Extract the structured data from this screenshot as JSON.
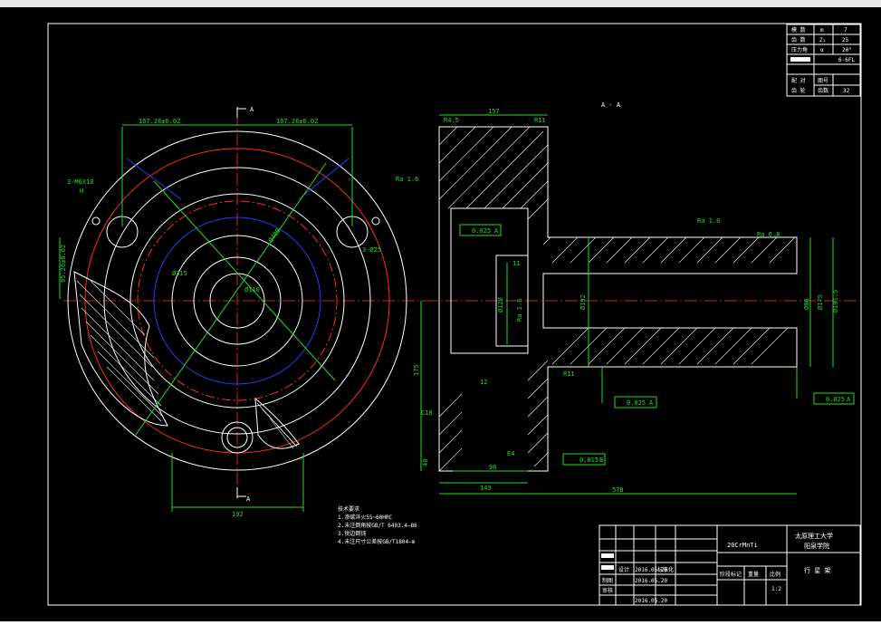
{
  "window": {
    "top_strip": ""
  },
  "drawing": {
    "section_label": "A - A",
    "cut_mark_top": "A",
    "cut_mark_bottom": "A",
    "colors": {
      "background": "#000000",
      "outline": "#ffffff",
      "center_lines": "#ff2a2a",
      "dimensions": "#20e020",
      "hidden": "#2a3cff"
    },
    "front_view_dims": {
      "d_left": "167.26±0.02",
      "d_right": "167.26±0.02",
      "hole_left": "3-M6X18",
      "hole_left_2": "H",
      "hole_right": "3-Ø25",
      "vert_left": "95.26±0.02",
      "ra_top": "Ra 1.6",
      "dia_large": "Ø400",
      "dia_mid": "Ø315",
      "dia_small": "Ø110",
      "bottom_width": "192"
    },
    "section_dims": {
      "r_top_left": "R4.5",
      "top_width": "157",
      "r_top_right": "R11",
      "ra1": "Ra 1.6",
      "ra2": "Ra 6.8",
      "tol1": "0.025",
      "tol1_ref": "A",
      "dim_11": "11",
      "dia_120": "Ø120",
      "ra_small": "Ra 1.6",
      "dia_192": "Ø192",
      "dia_175": "Ø175",
      "dia_86": "Ø86",
      "dia_191": "Ø191.5",
      "r_bottom": "R11",
      "dim_175": "175",
      "dim_12": "12",
      "tol2": "0.025",
      "tol2_ref": "A",
      "tol3": "0.025",
      "tol3_ref": "A",
      "c18": "C18",
      "dim_e4": "E4",
      "tol4": "0.015",
      "tol4_ref": "B",
      "dim_40": "40",
      "dim_96": "96",
      "dim_143": "143",
      "dim_578": "578"
    },
    "notes": {
      "title": "技术要求",
      "lines": [
        "1.渗碳淬火55~60HRC",
        "2.未注倒角按GB/T 6403.4—86",
        "3.锐边倒钝",
        "4.未注尺寸公差按GB/T1804—m"
      ]
    }
  },
  "param_table": {
    "rows": [
      {
        "a": "模 数",
        "b": "m",
        "c": "7"
      },
      {
        "a": "齿 数",
        "b": "Z₂",
        "c": "25"
      },
      {
        "a": "压力角",
        "b": "α",
        "c": "20°"
      },
      {
        "a": "",
        "b": "",
        "c": "6-6FL"
      },
      {
        "a": "",
        "b": "",
        "c": ""
      },
      {
        "a": "配 对",
        "b": "图号",
        "c": ""
      },
      {
        "a": "齿 轮",
        "b": "齿数",
        "c": "32"
      }
    ]
  },
  "title_block": {
    "material": "20CrMnTi",
    "school_line1": "太原理工大学",
    "school_line2": "阳泉学院",
    "part_name": "行 星 架",
    "stage_label": "阶段标记",
    "weight_label": "重量",
    "scale_label": "比例",
    "scale_value": "1:2",
    "designer_label": "设计",
    "standard_label": "标准化",
    "drafter_label": "制图",
    "reviewer_label": "审核",
    "date1": "2016.05.20",
    "date2": "2016.05.20",
    "date3": "2016.05.20"
  }
}
